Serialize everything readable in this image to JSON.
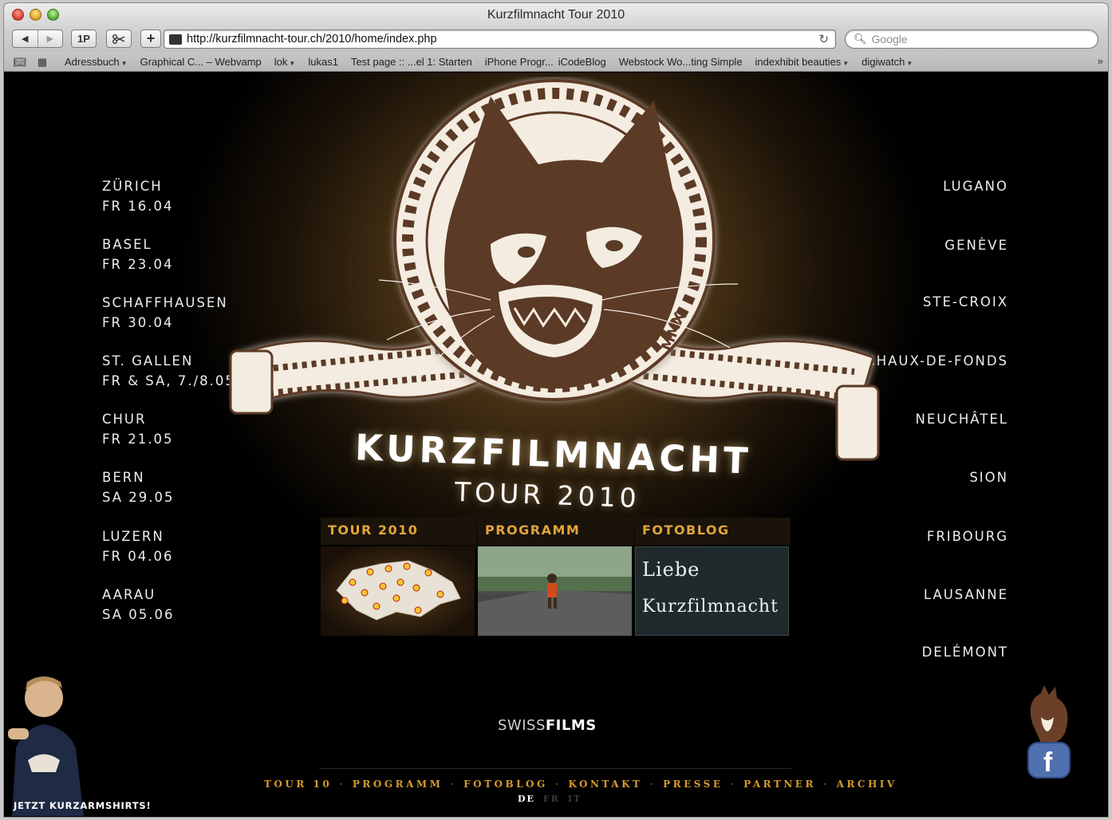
{
  "window": {
    "title": "Kurzfilmnacht Tour 2010"
  },
  "toolbar": {
    "back_icon": "back-arrow-icon",
    "forward_icon": "forward-arrow-icon",
    "onepassword_label": "1P",
    "snippet_icon": "scissors-icon",
    "add_label": "+",
    "url": "http://kurzfilmnacht-tour.ch/2010/home/index.php",
    "search_placeholder": "Google"
  },
  "bookmarks": {
    "items": [
      {
        "label": "Adressbuch",
        "menu": true
      },
      {
        "label": "Graphical C... – Webvamp",
        "menu": false
      },
      {
        "label": "lok",
        "menu": true
      },
      {
        "label": "lukas1",
        "menu": false
      },
      {
        "label": "Test page :: ...el 1: Starten",
        "menu": false
      },
      {
        "label": "iPhone Progr...",
        "menu": false
      },
      {
        "label": "iCodeBlog",
        "menu": false
      },
      {
        "label": "Webstock Wo...ting Simple",
        "menu": false
      },
      {
        "label": "indexhibit beauties",
        "menu": true
      },
      {
        "label": "digiwatch",
        "menu": true
      }
    ],
    "more": "»"
  },
  "page": {
    "left_cities": [
      {
        "name": "ZÜRICH",
        "date": "FR 16.04"
      },
      {
        "name": "BASEL",
        "date": "FR 23.04"
      },
      {
        "name": "SCHAFFHAUSEN",
        "date": "FR 30.04"
      },
      {
        "name": "ST. GALLEN",
        "date": "FR & SA, 7./8.05"
      },
      {
        "name": "CHUR",
        "date": "FR 21.05"
      },
      {
        "name": "BERN",
        "date": "SA 29.05"
      },
      {
        "name": "LUZERN",
        "date": "FR 04.06"
      },
      {
        "name": "AARAU",
        "date": "SA 05.06"
      }
    ],
    "right_cities": [
      "LUGANO",
      "GENÈVE",
      "STE-CROIX",
      "LA CHAUX-DE-FONDS",
      "NEUCHÂTEL",
      "SION",
      "FRIBOURG",
      "LAUSANNE",
      "DELÉMONT"
    ],
    "logo": {
      "title": "KURZFILMNACHT",
      "subtitle": "TOUR 2010",
      "ribbon_text": "MMX"
    },
    "tiles": [
      {
        "label": "TOUR 2010"
      },
      {
        "label": "PROGRAMM"
      },
      {
        "label": "FOTOBLOG",
        "chalk_line1": "Liebe",
        "chalk_line2": "Kurzfilmnacht"
      }
    ],
    "sponsor": {
      "light": "SWISS",
      "bold": "FILMS"
    },
    "footer_nav": [
      "TOUR 10",
      "PROGRAMM",
      "FOTOBLOG",
      "KONTAKT",
      "PRESSE",
      "PARTNER",
      "ARCHIV"
    ],
    "footer_sep": "·",
    "languages": [
      {
        "code": "DE",
        "active": true
      },
      {
        "code": "FR",
        "active": false
      },
      {
        "code": "IT",
        "active": false
      }
    ],
    "shirt_promo": "JETZT KURZARMSHIRTS!",
    "facebook_icon": "facebook-icon",
    "colors": {
      "accent": "#d69a2e",
      "tile_label": "#e2a43b",
      "logo_brown": "#5b3a26",
      "background": "#000000"
    }
  }
}
